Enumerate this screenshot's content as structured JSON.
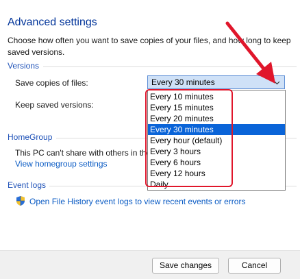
{
  "page": {
    "title": "Advanced settings",
    "description": "Choose how often you want to save copies of your files, and how long to keep saved versions."
  },
  "versions": {
    "group_label": "Versions",
    "save_copies_label": "Save copies of files:",
    "save_copies_value": "Every 30 minutes",
    "keep_versions_label": "Keep saved versions:",
    "dropdown_options": [
      "Every 10 minutes",
      "Every 15 minutes",
      "Every 20 minutes",
      "Every 30 minutes",
      "Every hour (default)",
      "Every 3 hours",
      "Every 6 hours",
      "Every 12 hours",
      "Daily"
    ],
    "selected_option": "Every 30 minutes"
  },
  "homegroup": {
    "group_label": "HomeGroup",
    "status_text": "This PC can't share with others in the",
    "settings_link": "View homegroup settings"
  },
  "event_logs": {
    "group_label": "Event logs",
    "open_link": "Open File History event logs to view recent events or errors",
    "icon": "uac-shield-icon"
  },
  "footer": {
    "save_label": "Save changes",
    "cancel_label": "Cancel"
  },
  "annotation": {
    "highlight_color": "#e0162b",
    "arrow_color": "#e0162b"
  },
  "colors": {
    "title": "#003399",
    "group_label": "#1f52b8",
    "link": "#0a5bc4",
    "selection": "#0a64d8"
  }
}
